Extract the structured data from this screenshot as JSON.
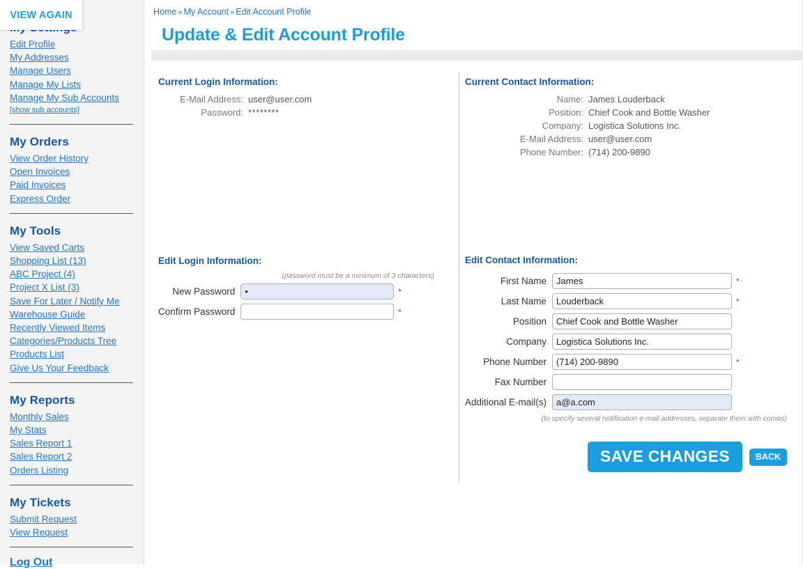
{
  "overlay": {
    "label": "VIEW AGAIN"
  },
  "sidebar": {
    "groups": [
      {
        "heading": "My Settings",
        "items": [
          {
            "label": "Edit Profile",
            "small": false
          },
          {
            "label": "My Addresses",
            "small": false
          },
          {
            "label": "Manage Users",
            "small": false
          },
          {
            "label": "Manage My Lists",
            "small": false
          },
          {
            "label": "Manage My Sub Accounts",
            "small": false
          },
          {
            "label": "[show sub accounts]",
            "small": true
          }
        ]
      },
      {
        "heading": "My Orders",
        "items": [
          {
            "label": "View Order History",
            "small": false
          },
          {
            "label": "Open Invoices",
            "small": false
          },
          {
            "label": "Paid Invoices",
            "small": false
          },
          {
            "label": "Express Order",
            "small": false
          }
        ]
      },
      {
        "heading": "My Tools",
        "items": [
          {
            "label": "View Saved Carts",
            "small": false
          },
          {
            "label": "Shopping List (13)",
            "small": false
          },
          {
            "label": "ABC Project (4)",
            "small": false
          },
          {
            "label": "Project X List (3)",
            "small": false
          },
          {
            "label": "Save For Later / Notify Me",
            "small": false
          },
          {
            "label": "Warehouse Guide",
            "small": false
          },
          {
            "label": "Recently Viewed Items",
            "small": false
          },
          {
            "label": "Categories/Products Tree",
            "small": false
          },
          {
            "label": "Products List",
            "small": false
          },
          {
            "label": "Give Us Your Feedback",
            "small": false
          }
        ]
      },
      {
        "heading": "My Reports",
        "items": [
          {
            "label": "Monthly Sales",
            "small": false
          },
          {
            "label": "My Stats",
            "small": false
          },
          {
            "label": "Sales Report 1",
            "small": false
          },
          {
            "label": "Sales Report 2",
            "small": false
          },
          {
            "label": "Orders Listing",
            "small": false
          }
        ]
      },
      {
        "heading": "My Tickets",
        "items": [
          {
            "label": "Submit Request",
            "small": false
          },
          {
            "label": "View Request",
            "small": false
          }
        ]
      }
    ],
    "logout": "Log Out"
  },
  "breadcrumb": {
    "items": [
      "Home",
      "My Account",
      "Edit Account Profile"
    ],
    "separator": "»"
  },
  "header": {
    "title": "Update & Edit Account Profile"
  },
  "current_login": {
    "title": "Current Login Information:",
    "rows": [
      {
        "label": "E-Mail Address:",
        "value": "user@user.com"
      },
      {
        "label": "Password:",
        "value": "********"
      }
    ]
  },
  "current_contact": {
    "title": "Current Contact Information:",
    "rows": [
      {
        "label": "Name:",
        "value": "James Louderback"
      },
      {
        "label": "Position:",
        "value": "Chief Cook and Bottle Washer"
      },
      {
        "label": "Company:",
        "value": "Logistica Solutions Inc."
      },
      {
        "label": "E-Mail Address:",
        "value": "user@user.com"
      },
      {
        "label": "Phone Number:",
        "value": "(714) 200-9890"
      }
    ]
  },
  "edit_login": {
    "title": "Edit Login Information:",
    "hint": "(password must be a minimum of 3 characters)",
    "fields": [
      {
        "label": "New Password",
        "value": "•",
        "placeholder": "",
        "required": "*",
        "filled": true
      },
      {
        "label": "Confirm Password",
        "value": "",
        "placeholder": "",
        "required": "*",
        "filled": false
      }
    ]
  },
  "edit_contact": {
    "title": "Edit Contact Information:",
    "hint": "(to specify several notification e-mail addresses, separate them with comas)",
    "fields": [
      {
        "label": "First Name",
        "value": "James",
        "placeholder": "",
        "required": "*",
        "filled": false
      },
      {
        "label": "Last Name",
        "value": "Louderback",
        "placeholder": "",
        "required": "*",
        "filled": false
      },
      {
        "label": "Position",
        "value": "Chief Cook and Bottle Washer",
        "placeholder": "",
        "required": "",
        "filled": false
      },
      {
        "label": "Company",
        "value": "Logistica Solutions Inc.",
        "placeholder": "",
        "required": "",
        "filled": false
      },
      {
        "label": "Phone Number",
        "value": "(714) 200-9890",
        "placeholder": "",
        "required": "*",
        "filled": false
      },
      {
        "label": "Fax Number",
        "value": "",
        "placeholder": "",
        "required": "",
        "filled": false
      },
      {
        "label": "Additional E-mail(s)",
        "value": "a@a.com",
        "placeholder": "",
        "required": "",
        "filled": true
      }
    ],
    "save_label": "SAVE CHANGES",
    "back_label": "BACK"
  },
  "colors": {
    "accent_blue": "#1b9ee0",
    "heading_blue": "#1159b0",
    "link_blue": "#2277cc",
    "sidebar_bg": "#f4f4f4",
    "bar_gray": "#e9eaec",
    "field_filled": "#e2eaf8"
  }
}
